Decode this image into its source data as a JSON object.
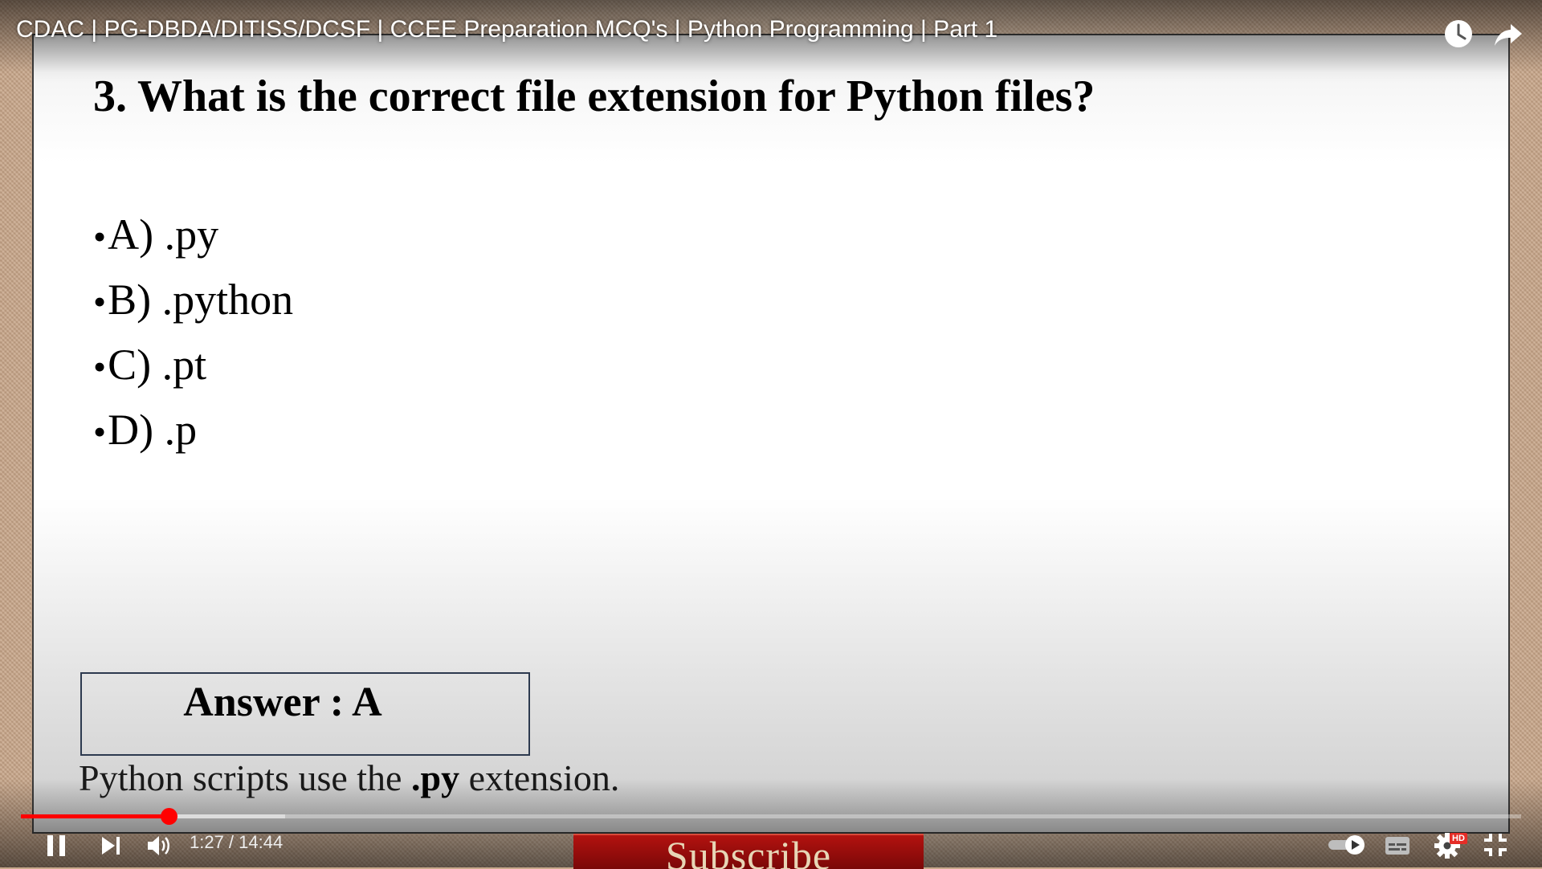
{
  "video": {
    "title": "CDAC | PG-DBDA/DITISS/DCSF | CCEE Preparation MCQ's | Python Programming | Part 1",
    "current_time": "1:27",
    "duration": "14:44",
    "time_display": "1:27 / 14:44",
    "progress_fraction": 0.0983,
    "buffered_fraction": 0.176,
    "quality_badge": "HD",
    "accent_color": "#ff0000"
  },
  "slide": {
    "question": "3. What is the correct file extension for Python files?",
    "options": [
      {
        "bullet": "•",
        "text": "A) .py"
      },
      {
        "bullet": "•",
        "text": "B) .python"
      },
      {
        "bullet": "•",
        "text": "C) .pt"
      },
      {
        "bullet": "•",
        "text": "D) .p"
      }
    ],
    "answer": "Answer : A",
    "explanation": {
      "before": "Python scripts use the ",
      "bold": ".py",
      "after": " extension."
    }
  },
  "overlay": {
    "subscribe_text": "Subscribe"
  },
  "icons": {
    "watch_later": "clock-icon",
    "share": "share-icon",
    "play_pause": "pause-icon",
    "next": "next-icon",
    "volume": "volume-icon",
    "autoplay": "autoplay-toggle-icon",
    "captions": "captions-icon",
    "settings": "gear-icon",
    "fullscreen_exit": "exit-fullscreen-icon"
  }
}
